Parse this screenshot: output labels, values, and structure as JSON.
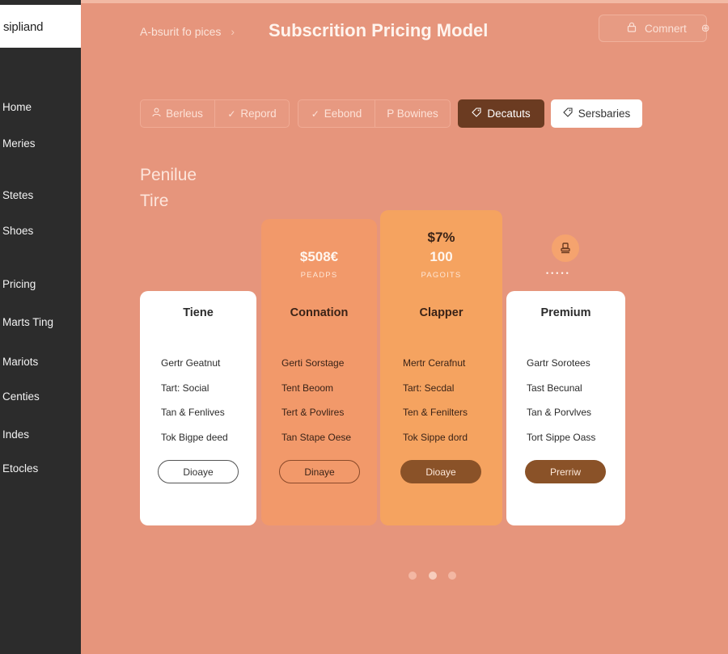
{
  "app": {
    "brand": "sipliand"
  },
  "sidebar": {
    "items": [
      {
        "label": "Home"
      },
      {
        "label": "Meries"
      },
      {
        "label": "Stetes"
      },
      {
        "label": "Shoes"
      },
      {
        "label": "Pricing"
      },
      {
        "label": "Marts Ting"
      },
      {
        "label": "Mariots"
      },
      {
        "label": "Centies"
      },
      {
        "label": "Indes"
      },
      {
        "label": "Etocles"
      }
    ]
  },
  "header": {
    "breadcrumb": "A-bsurit fo pices",
    "title": "Subscrition Pricing Model",
    "comment_label": "Comnert"
  },
  "filters": {
    "group1": [
      {
        "label": "Berleus",
        "icon": "user-icon"
      },
      {
        "label": "Repord",
        "icon": "check-icon"
      }
    ],
    "group2": [
      {
        "label": "Eebond",
        "icon": "check-icon"
      },
      {
        "label": "P Bowines",
        "icon": "none"
      }
    ],
    "dark_button": "Decatuts",
    "white_button": "Sersbaries"
  },
  "section": {
    "title_line1": "Penilue",
    "title_line2": "Tire"
  },
  "tiers": [
    {
      "name": "Tiene",
      "price": "",
      "sub": "",
      "features": [
        "Gertr Geatnut",
        "Tart: Social",
        "Tan & Fenlives",
        "Tok Bigpe deed"
      ],
      "cta": "Dioaye"
    },
    {
      "name": "Connation",
      "price": "$508€",
      "sub": "PEADPS",
      "features": [
        "Gerti Sorstage",
        "Tent Beoom",
        "Tert & Povlires",
        "Tan Stape Oese"
      ],
      "cta": "Dinaye"
    },
    {
      "name": "Clapper",
      "price_line1": "$7%",
      "price_line2": "100",
      "sub": "PAGOITS",
      "features": [
        "Mertr Cerafnut",
        "Tart: Secdal",
        "Ten & Fenilters",
        "Tok Sippe dord"
      ],
      "cta": "Dioaye"
    },
    {
      "name": "Premium",
      "price": "",
      "sub": "",
      "features": [
        "Gartr Sorotees",
        "Tast Becunal",
        "Tan & Porvlves",
        "Tort Sippe Oass"
      ],
      "cta": "Prerriw"
    }
  ],
  "colors": {
    "background": "#e6957c",
    "sidebar": "#2c2c2c",
    "accent_dark": "#6b3b21",
    "cta_brown": "#8a5228"
  },
  "pager": {
    "count": 3,
    "active": 1
  }
}
